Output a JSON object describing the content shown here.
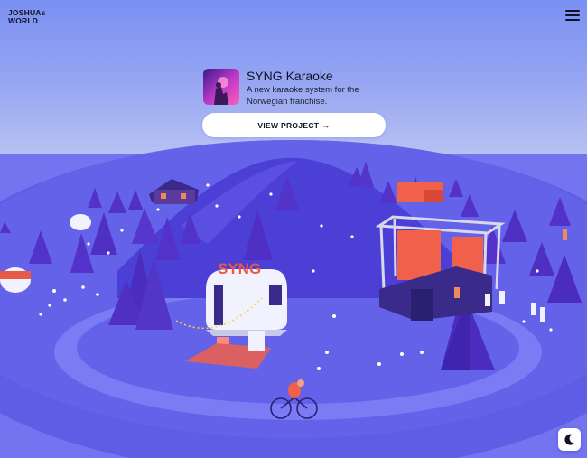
{
  "header": {
    "logo_line1": "JOSHUAs",
    "logo_line2": "WORLD",
    "menu_icon": "hamburger-menu-icon"
  },
  "project_card": {
    "title": "SYNG Karaoke",
    "description": "A new karaoke system for the Norwegian franchise.",
    "button_label": "VIEW PROJECT",
    "button_icon": "arrow-right-icon",
    "arrow_glyph": "→"
  },
  "scene": {
    "sign_text": "SYNG",
    "colors": {
      "sky_top": "#7a90f2",
      "ground": "#6f72ef",
      "hill": "#4b3fd6",
      "trees": "#5a3fd0",
      "stage_screen": "#f0604a"
    }
  },
  "theme_toggle": {
    "icon": "moon-icon"
  }
}
